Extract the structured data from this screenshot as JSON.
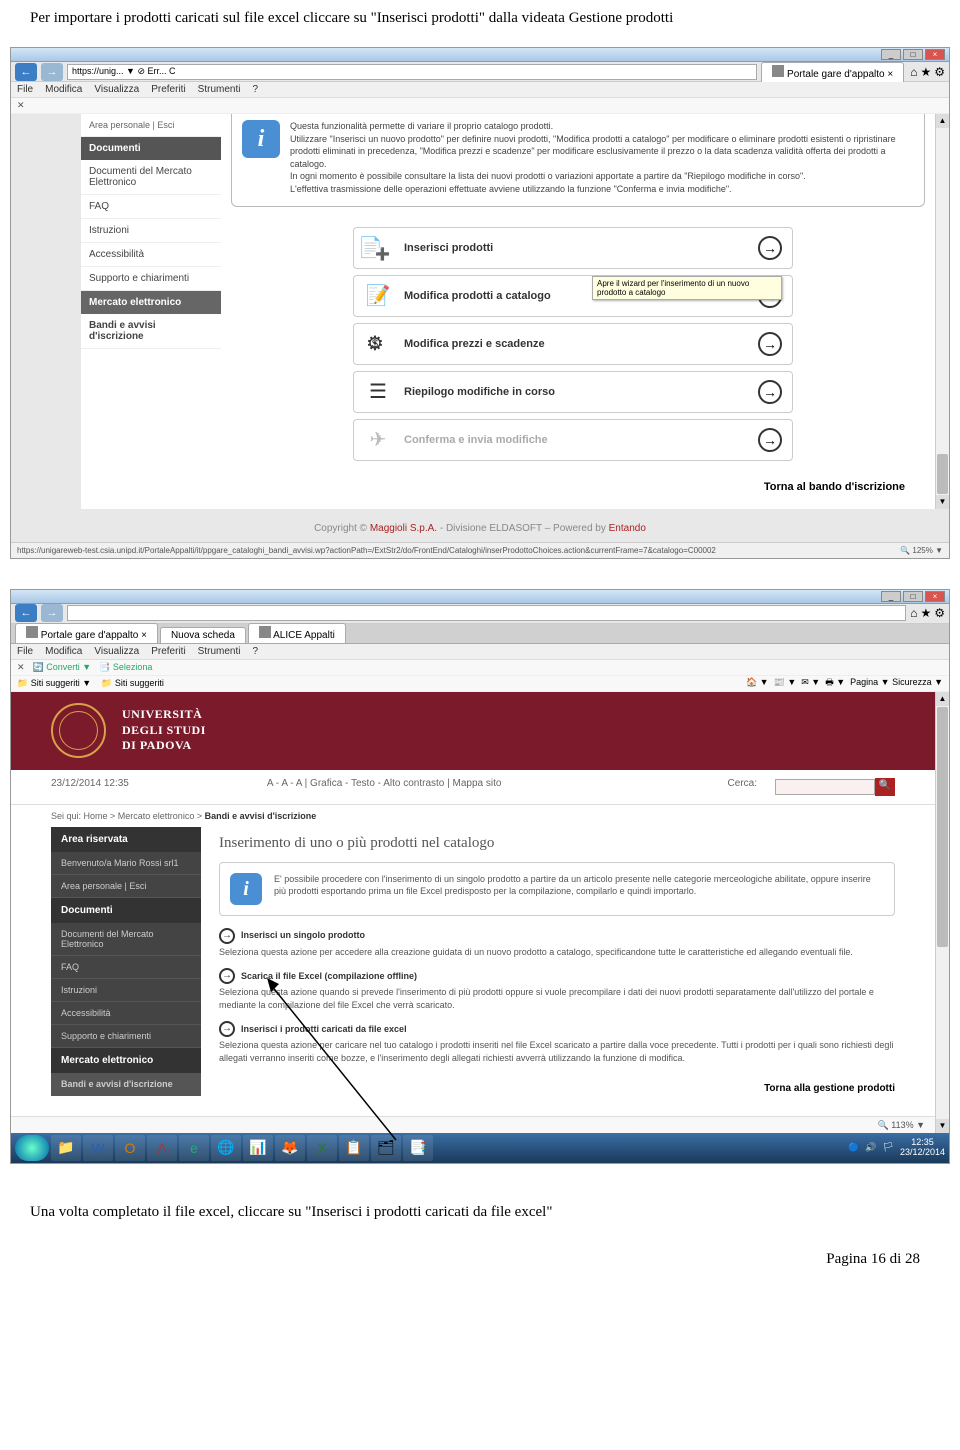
{
  "doc": {
    "intro": "Per importare i prodotti caricati sul file excel cliccare su \"Inserisci prodotti\" dalla videata Gestione prodotti",
    "outro": "Una volta completato il file excel, cliccare su \"Inserisci i prodotti caricati da file excel\"",
    "page_num": "Pagina 16 di 28"
  },
  "s1": {
    "win_min": "_",
    "win_max": "□",
    "win_close": "×",
    "addr_hint": "https://unig... ▼ ⊘ Err... C",
    "tab1": "Portale gare d'appalto",
    "menu": [
      "File",
      "Modifica",
      "Visualizza",
      "Preferiti",
      "Strumenti",
      "?"
    ],
    "sidebar": {
      "top_small": "Area personale | Esci",
      "head1": "Documenti",
      "i1": "Documenti del Mercato Elettronico",
      "i2": "FAQ",
      "i3": "Istruzioni",
      "i4": "Accessibilità",
      "i5": "Supporto e chiarimenti",
      "head2": "Mercato elettronico",
      "i6": "Bandi e avvisi d'iscrizione"
    },
    "info": {
      "l1": "Questa funzionalità permette di variare il proprio catalogo prodotti.",
      "l2": "Utilizzare \"Inserisci un nuovo prodotto\" per definire nuovi prodotti, \"Modifica prodotti a catalogo\" per modificare o eliminare prodotti esistenti o ripristinare prodotti eliminati in precedenza, \"Modifica prezzi e scadenze\" per modificare esclusivamente il prezzo o la data scadenza validità offerta dei prodotti a catalogo.",
      "l3": "In ogni momento è possibile consultare la lista dei nuovi prodotti o variazioni apportate a partire da \"Riepilogo modifiche in corso\".",
      "l4": "L'effettiva trasmissione delle operazioni effettuate avviene utilizzando la funzione \"Conferma e invia modifiche\"."
    },
    "actions": {
      "a1": "Inserisci prodotti",
      "a2": "Modifica prodotti a catalogo",
      "a3": "Modifica prezzi e scadenze",
      "a4": "Riepilogo modifiche in corso",
      "a5": "Conferma e invia modifiche",
      "tooltip": "Apre il wizard per l'inserimento di un nuovo prodotto a catalogo"
    },
    "back": "Torna al bando d'iscrizione",
    "copyright_pre": "Copyright © ",
    "copyright_a1": "Maggioli S.p.A.",
    "copyright_mid": " - Divisione ELDASOFT – Powered by ",
    "copyright_a2": "Entando",
    "status_url": "https://unigareweb-test.csia.unipd.it/PortaleAppalti/it/ppgare_cataloghi_bandi_avvisi.wp?actionPath=/ExtStr2/do/FrontEnd/Cataloghi/inserProdottoChoices.action&currentFrame=7&catalogo=C00002",
    "zoom": "🔍 125%  ▼"
  },
  "s2": {
    "tabs": {
      "t1": "Portale gare d'appalto",
      "t2": "Nuova scheda",
      "t3": "ALICE Appalti"
    },
    "menu": [
      "File",
      "Modifica",
      "Visualizza",
      "Preferiti",
      "Strumenti",
      "?"
    ],
    "tb2": {
      "l1": "Converti ▼",
      "l2": "Seleziona",
      "l3": "Siti suggeriti ▼",
      "l4": "Siti suggeriti"
    },
    "tb_right": "Pagina ▼  Sicurezza ▼",
    "uni": {
      "l1": "UNIVERSITÀ",
      "l2": "DEGLI STUDI",
      "l3": "DI PADOVA"
    },
    "util": {
      "date": "23/12/2014 12:35",
      "acc": "A - A - A | Grafica - Testo - Alto contrasto | Mappa sito",
      "search_lbl": "Cerca:"
    },
    "breadcrumb": "Sei qui: Home > Mercato elettronico > ",
    "breadcrumb_b": "Bandi e avvisi d'iscrizione",
    "sidebar": {
      "h1": "Area riservata",
      "welcome": "Benvenuto/a Mario Rossi srl1",
      "area": "Area personale | Esci",
      "h2": "Documenti",
      "i1": "Documenti del Mercato Elettronico",
      "i2": "FAQ",
      "i3": "Istruzioni",
      "i4": "Accessibilità",
      "i5": "Supporto e chiarimenti",
      "h3": "Mercato elettronico",
      "i6": "Bandi e avvisi d'iscrizione"
    },
    "title": "Inserimento di uno o più prodotti nel catalogo",
    "info": "E' possibile procedere con l'inserimento di un singolo prodotto a partire da un articolo presente nelle categorie merceologiche abilitate, oppure inserire più prodotti esportando prima un file Excel predisposto per la compilazione, compilarlo e quindi importarlo.",
    "opt1": {
      "t": "Inserisci un singolo prodotto",
      "d": "Seleziona questa azione per accedere alla creazione guidata di un nuovo prodotto a catalogo, specificandone tutte le caratteristiche ed allegando eventuali file."
    },
    "opt2": {
      "t": "Scarica il file Excel (compilazione offline)",
      "d": "Seleziona questa azione quando si prevede l'inserimento di più prodotti oppure si vuole precompilare i dati dei nuovi prodotti separatamente dall'utilizzo del portale e mediante la compilazione del file Excel che verrà scaricato."
    },
    "opt3": {
      "t": "Inserisci i prodotti caricati da file excel",
      "d": "Seleziona questa azione per caricare nel tuo catalogo i prodotti inseriti nel file Excel scaricato a partire dalla voce precedente. Tutti i prodotti per i quali sono richiesti degli allegati verranno inseriti come bozze, e l'inserimento degli allegati richiesti avverrà utilizzando la funzione di modifica."
    },
    "back": "Torna alla gestione prodotti",
    "zoom": "🔍 113%  ▼",
    "clock": {
      "time": "12:35",
      "date": "23/12/2014"
    }
  }
}
